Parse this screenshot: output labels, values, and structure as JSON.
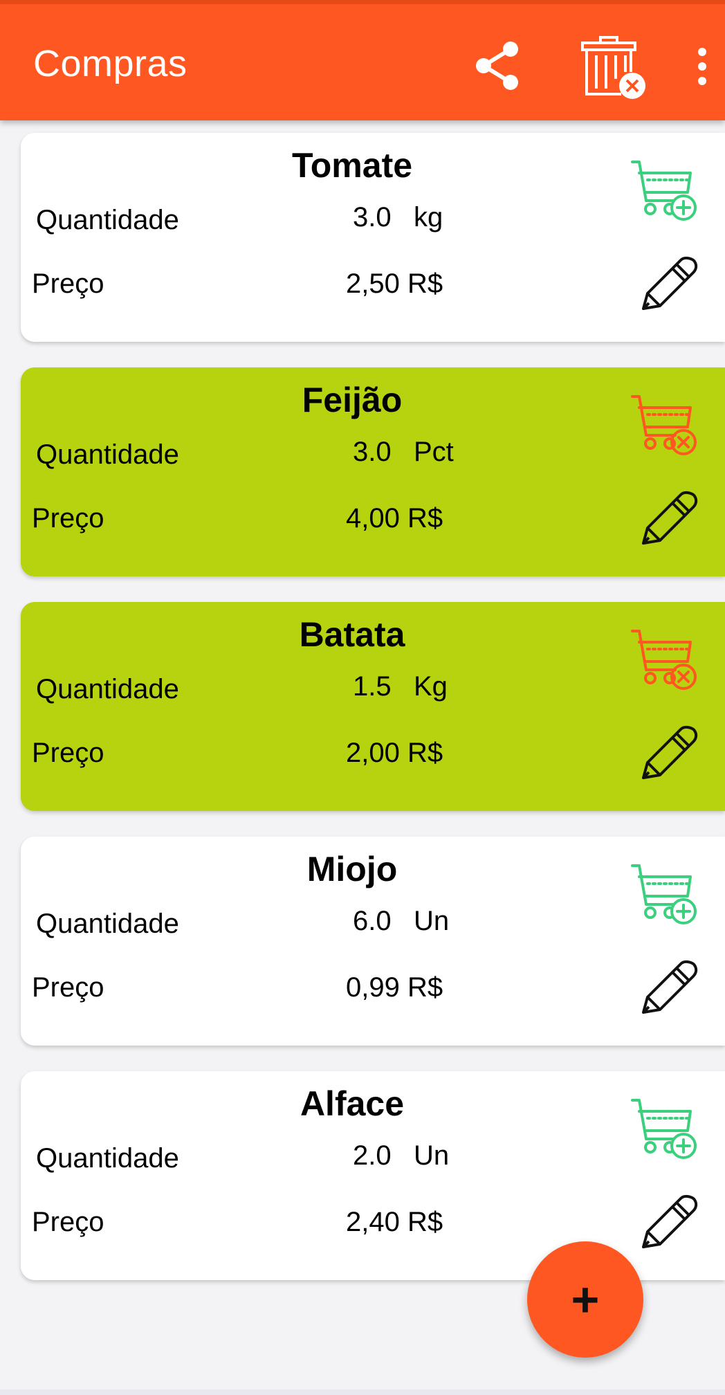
{
  "app_bar": {
    "title": "Compras",
    "background_color": "#ff5722",
    "actions": [
      {
        "icon": "share-icon"
      },
      {
        "icon": "delete-all-icon"
      },
      {
        "icon": "overflow-menu-icon"
      }
    ]
  },
  "labels": {
    "quantity": "Quantidade",
    "price": "Preço"
  },
  "colors": {
    "in_cart_card": "#b7d20f",
    "default_card": "#ffffff",
    "add_cart_icon": "#3ccf7e",
    "remove_cart_icon": "#ff5722"
  },
  "items": [
    {
      "name": "Tomate",
      "quantity": "3.0",
      "unit": "kg",
      "price": "2,50 R$",
      "in_cart": false,
      "cart_icon": "cart-add-icon"
    },
    {
      "name": "Feijão",
      "quantity": "3.0",
      "unit": "Pct",
      "price": "4,00 R$",
      "in_cart": true,
      "cart_icon": "cart-remove-icon"
    },
    {
      "name": "Batata",
      "quantity": "1.5",
      "unit": "Kg",
      "price": "2,00 R$",
      "in_cart": true,
      "cart_icon": "cart-remove-icon"
    },
    {
      "name": "Miojo",
      "quantity": "6.0",
      "unit": "Un",
      "price": "0,99 R$",
      "in_cart": false,
      "cart_icon": "cart-add-icon"
    },
    {
      "name": "Alface",
      "quantity": "2.0",
      "unit": "Un",
      "price": "2,40 R$",
      "in_cart": false,
      "cart_icon": "cart-add-icon"
    }
  ],
  "fab": {
    "icon": "plus-icon",
    "label": "+"
  }
}
